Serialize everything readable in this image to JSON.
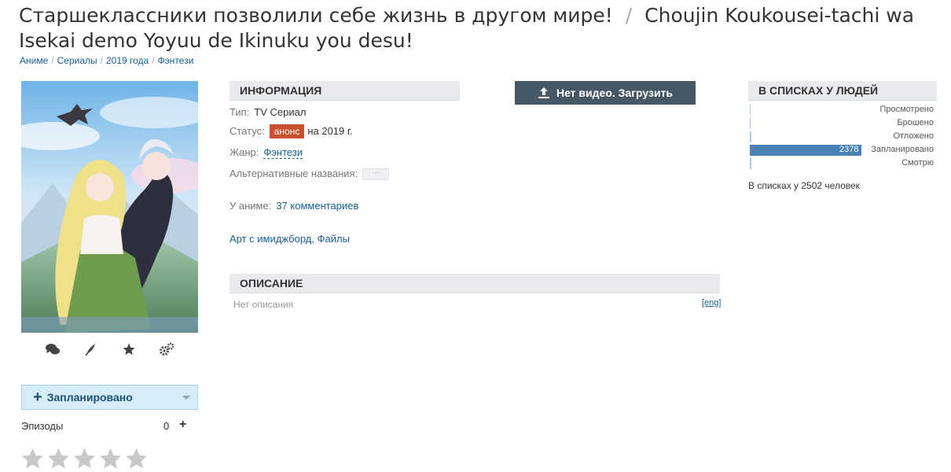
{
  "title": {
    "russian": "Старшеклассники позволили себе жизнь в другом мире!",
    "separator": "/",
    "romaji": "Choujin Koukousei-tachi wa Isekai demo Yoyuu de Ikinuku you desu!"
  },
  "breadcrumbs": [
    "Аниме",
    "Сериалы",
    "2019 года",
    "Фэнтези"
  ],
  "actions": {
    "icons": [
      "comments-icon",
      "feather-icon",
      "star-icon",
      "gears-icon"
    ]
  },
  "rate": {
    "label": "Запланировано",
    "plus": "+"
  },
  "episodes": {
    "label": "Эпизоды",
    "value": "0",
    "increment": "+"
  },
  "stars": {
    "count": 5,
    "filled": 0,
    "color": "#c8c8c8"
  },
  "info": {
    "header": "ИНФОРМАЦИЯ",
    "type_key": "Тип:",
    "type_val": "TV Сериал",
    "status_key": "Статус:",
    "status_badge": "анонс",
    "status_val": "на 2019 г.",
    "genre_key": "Жанр:",
    "genre_val": "Фэнтези",
    "alt_key": "Альтернативные названия:",
    "alt_val": "···",
    "comments_key": "У аниме:",
    "comments_val": "37 комментариев",
    "art_link": "Арт с имиджборд",
    "art_sep": ",",
    "files_link": "Файлы"
  },
  "upload": {
    "label": "Нет видео. Загрузить"
  },
  "description": {
    "header": "ОПИСАНИЕ",
    "empty": "Нет описания",
    "lang": "[eng]"
  },
  "lists": {
    "header": "В СПИСКАХ У ЛЮДЕЙ",
    "rows": [
      {
        "label": "Просмотрено",
        "count": "",
        "value": 0
      },
      {
        "label": "Брошено",
        "count": "",
        "value": 0
      },
      {
        "label": "Отложено",
        "count": "",
        "value": 4
      },
      {
        "label": "Запланировано",
        "count": "2378",
        "value": 2378
      },
      {
        "label": "Смотрю",
        "count": "",
        "value": 10
      }
    ],
    "total": "В списках у 2502 человек",
    "colors": {
      "bar": "#a9c9e2",
      "main": "#4b82b6"
    }
  }
}
